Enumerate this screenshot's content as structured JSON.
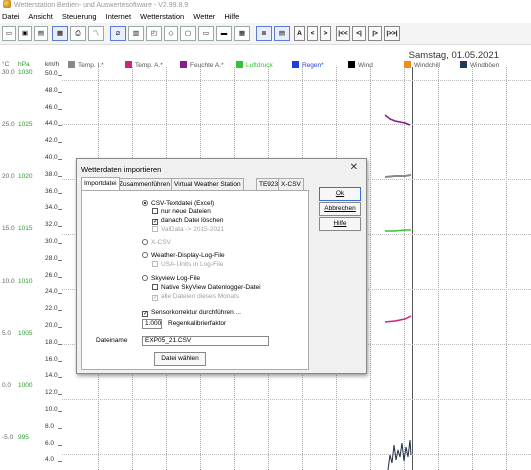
{
  "window": {
    "title": "Wetterstation Bedien- und Auswertesoftware - V2.99.8.9"
  },
  "menu": [
    "Datei",
    "Ansicht",
    "Steuerung",
    "Internet",
    "Wetterstation",
    "Wetter",
    "Hilfe"
  ],
  "toolbar": {
    "a_label": "A",
    "prev_label": "<",
    "next_label": ">",
    "nav_first": "|<<",
    "nav_prev": "<|",
    "nav_next": "|>",
    "nav_last": "|>>|"
  },
  "chart": {
    "date": "Samstag, 01.05.2021",
    "units": {
      "temp": "°C",
      "pressure": "hPa",
      "wind": "km/h"
    },
    "legend": [
      {
        "label": "Temp. I.*",
        "color": "#888888"
      },
      {
        "label": "Temp. A.*",
        "color": "#d0247c"
      },
      {
        "label": "Feuchte A.*",
        "color": "#8b1a8b"
      },
      {
        "label": "Luftdruck",
        "color": "#36c236"
      },
      {
        "label": "Regen*",
        "color": "#1f3fd8"
      },
      {
        "label": "Wind",
        "color": "#000000"
      },
      {
        "label": "Windchill",
        "color": "#f08c1a"
      },
      {
        "label": "Windböen",
        "color": "#223a55"
      }
    ],
    "temp_ticks": [
      "30.0",
      "25.0",
      "20.0",
      "15.0",
      "10.0",
      "5.0",
      "0.0",
      "-5.0"
    ],
    "pressure_ticks": [
      "1030",
      "1025",
      "1020",
      "1015",
      "1010",
      "1005",
      "1000",
      "995"
    ],
    "wind_ticks": [
      "50.0",
      "48.0",
      "46.0",
      "44.0",
      "42.0",
      "40.0",
      "38.0",
      "36.0",
      "34.0",
      "32.0",
      "30.0",
      "28.0",
      "26.0",
      "24.0",
      "22.0",
      "20.0",
      "18.0",
      "16.0",
      "14.0",
      "12.0",
      "10.0",
      "8.0",
      "6.0",
      "4.0"
    ]
  },
  "dialog": {
    "title": "Wetterdaten importieren",
    "tabs": [
      "Importdatei",
      "Zusammenführen",
      "Virtual Weather Station",
      "TE923",
      "X-CSV"
    ],
    "buttons": {
      "ok": "Ok",
      "cancel": "Abbrechen",
      "help": "Hilfe"
    },
    "options": {
      "csv": "CSV-Textdatei (Excel)",
      "nur_neue": "nur neue Dateien",
      "loeschen": "danach Datei löschen",
      "valdata": "ValData ->   2015-2021",
      "xcsv": "X-CSV",
      "weather_display": "Weather-Display-Log-File",
      "usa_units": "USA-Units in Log-File",
      "skyview": "Skyview Log-File",
      "native": "Native SkyView Datenlogger-Datei",
      "alle_dateien": "alle Dateien dieses Monats",
      "sensorkorrektur": "Sensorkorrektur durchführen ...",
      "regen_value": "1.000",
      "regen_label": "Regenkalibrierfaktor",
      "dateiname_label": "Dateiname",
      "dateiname_value": "EXP05_21.CSV",
      "datei_waehlen": "Datei wählen"
    }
  }
}
